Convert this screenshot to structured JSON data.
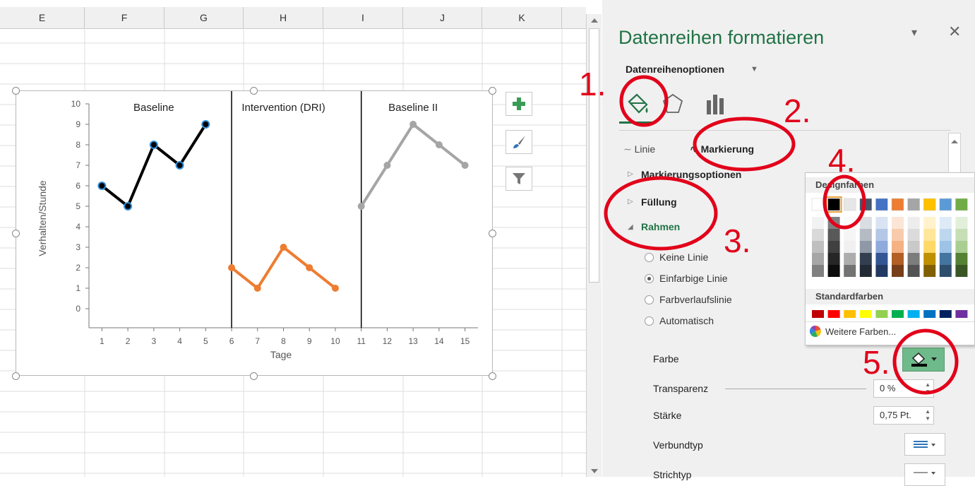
{
  "spreadsheet": {
    "columns": [
      "E",
      "F",
      "G",
      "H",
      "I",
      "J",
      "K"
    ]
  },
  "chart_data": {
    "type": "line",
    "panels": [
      {
        "title": "Baseline",
        "series": [
          {
            "x": [
              1,
              2,
              3,
              4,
              5
            ],
            "values": [
              6,
              5,
              8,
              7,
              9
            ],
            "color": "#000000",
            "marker_color": "#2e8fd8"
          }
        ]
      },
      {
        "title": "Intervention (DRI)",
        "series": [
          {
            "x": [
              6,
              7,
              8,
              9,
              10
            ],
            "values": [
              2,
              1,
              3,
              2,
              1
            ],
            "color": "#ed7d31"
          }
        ]
      },
      {
        "title": "Baseline II",
        "series": [
          {
            "x": [
              11,
              12,
              13,
              14,
              15
            ],
            "values": [
              5,
              7,
              9,
              8,
              7
            ],
            "color": "#a5a5a5"
          }
        ]
      }
    ],
    "x_ticks": [
      "1",
      "2",
      "3",
      "4",
      "5",
      "6",
      "7",
      "8",
      "9",
      "10",
      "11",
      "12",
      "13",
      "14",
      "15"
    ],
    "y_ticks": [
      "0",
      "1",
      "2",
      "3",
      "4",
      "5",
      "6",
      "7",
      "8",
      "9",
      "10"
    ],
    "ylim": [
      0,
      10
    ],
    "xlabel": "Tage",
    "ylabel": "Verhalten/Stunde",
    "grid": false
  },
  "chart_tools": {
    "buttons": [
      "chart-elements",
      "chart-styles",
      "chart-filters"
    ]
  },
  "format_pane": {
    "title": "Datenreihen formatieren",
    "series_options": "Datenreihenoptionen",
    "tabs": [
      "fill-line",
      "effects",
      "series-options"
    ],
    "subtabs": {
      "line": "Linie",
      "marker": "Markierung"
    },
    "sections": {
      "marker_options": "Markierungsoptionen",
      "fill": "Füllung",
      "border": "Rahmen"
    },
    "border_options": [
      "Keine Linie",
      "Einfarbige Linie",
      "Farbverlaufslinie",
      "Automatisch"
    ],
    "selected_border_option": "Einfarbige Linie",
    "properties": {
      "color_label": "Farbe",
      "transparency_label": "Transparenz",
      "transparency_value": "0 %",
      "width_label": "Stärke",
      "width_value": "0,75 Pt.",
      "compound_label": "Verbundtyp",
      "dash_label": "Strichtyp"
    }
  },
  "color_palette": {
    "theme_header": "Designfarben",
    "theme_colors": [
      "#ffffff",
      "#000000",
      "#e7e6e6",
      "#44546a",
      "#4472c4",
      "#ed7d31",
      "#a5a5a5",
      "#ffc000",
      "#5b9bd5",
      "#70ad47"
    ],
    "selected_color": "#000000",
    "standard_header": "Standardfarben",
    "standard_colors": [
      "#c00000",
      "#ff0000",
      "#ffc000",
      "#ffff00",
      "#92d050",
      "#00b050",
      "#00b0f0",
      "#0070c0",
      "#002060",
      "#7030a0"
    ],
    "more_colors": "Weitere Farben..."
  },
  "annotations": [
    "1.",
    "2.",
    "3.",
    "4.",
    "5."
  ]
}
